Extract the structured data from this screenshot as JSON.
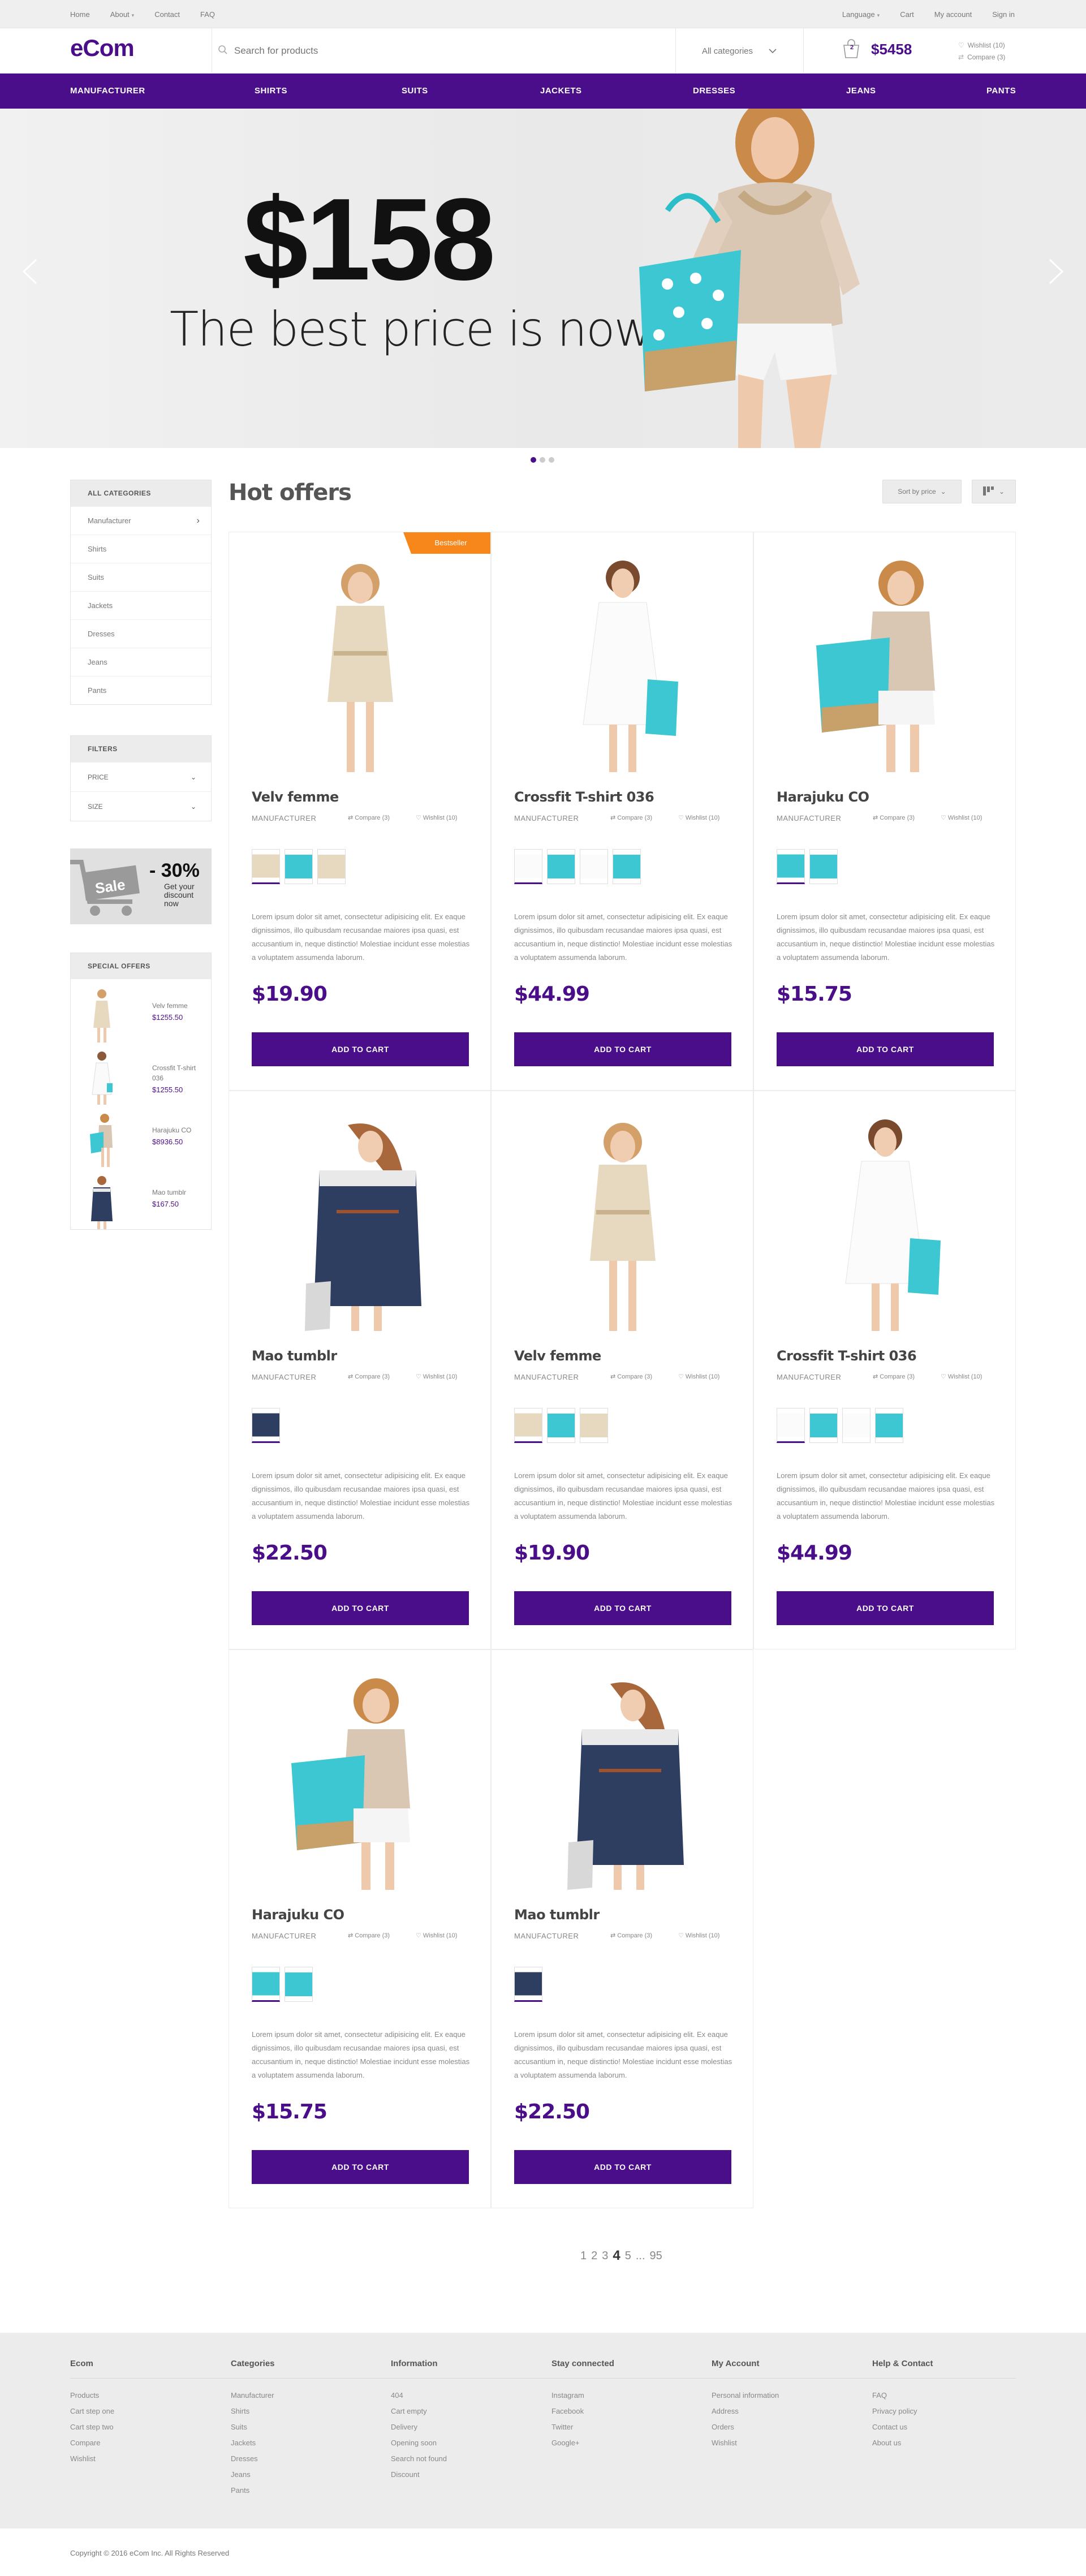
{
  "topbar": {
    "left": [
      "Home",
      "About",
      "Contact",
      "FAQ"
    ],
    "right": [
      "Language",
      "Cart",
      "My account",
      "Sign in"
    ]
  },
  "header": {
    "logo": "eCom",
    "search_placeholder": "Search for products",
    "category_select": "All categories",
    "cart_count": "2",
    "cart_total": "$5458",
    "wishlist": "Wishlist (10)",
    "compare": "Compare (3)"
  },
  "nav": [
    "MANUFACTURER",
    "SHIRTS",
    "SUITS",
    "JACKETS",
    "DRESSES",
    "JEANS",
    "PANTS"
  ],
  "hero": {
    "price": "$158",
    "tagline": "The best price is now"
  },
  "sidebar": {
    "categories_title": "ALL CATEGORIES",
    "categories": [
      "Manufacturer",
      "Shirts",
      "Suits",
      "Jackets",
      "Dresses",
      "Jeans",
      "Pants"
    ],
    "filters_title": "FILTERS",
    "filters": [
      "PRICE",
      "SIZE"
    ],
    "sale": {
      "label": "Sale",
      "discount": "- 30%",
      "line1": "Get your",
      "line2": "discount",
      "line3": "now"
    },
    "special_title": "SPECIAL OFFERS",
    "special": [
      {
        "name": "Velv femme",
        "price": "$1255.50"
      },
      {
        "name": "Crossfit T-shirt 036",
        "price": "$1255.50"
      },
      {
        "name": "Harajuku CO",
        "price": "$8936.50"
      },
      {
        "name": "Mao tumblr",
        "price": "$167.50"
      }
    ]
  },
  "main": {
    "title": "Hot offers",
    "sort_label": "Sort by price",
    "badge": "Bestseller",
    "manufacturer": "MANUFACTURER",
    "compare": "Compare (3)",
    "wishlist": "Wishlist (10)",
    "add_to_cart": "ADD TO CART",
    "description": "Lorem ipsum dolor sit amet, consectetur adipisicing elit. Ex eaque dignissimos, illo quibusdam recusandae maiores ipsa quasi, est accusantium in, neque distinctio! Molestiae incidunt esse molestias a voluptatem assumenda laborum.",
    "products": [
      {
        "name": "Velv femme",
        "price": "$19.90"
      },
      {
        "name": "Crossfit T-shirt 036",
        "price": "$44.99"
      },
      {
        "name": "Harajuku CO",
        "price": "$15.75"
      },
      {
        "name": "Mao tumblr",
        "price": "$22.50"
      },
      {
        "name": "Velv femme",
        "price": "$19.90"
      },
      {
        "name": "Crossfit T-shirt 036",
        "price": "$44.99"
      },
      {
        "name": "Harajuku CO",
        "price": "$15.75"
      },
      {
        "name": "Mao tumblr",
        "price": "$22.50"
      }
    ],
    "pagination": [
      "1",
      "2",
      "3",
      "4",
      "5",
      "...",
      "95"
    ]
  },
  "footer": {
    "columns": [
      {
        "title": "Ecom",
        "links": [
          "Products",
          "Cart step one",
          "Cart step two",
          "Compare",
          "Wishlist"
        ]
      },
      {
        "title": "Categories",
        "links": [
          "Manufacturer",
          "Shirts",
          "Suits",
          "Jackets",
          "Dresses",
          "Jeans",
          "Pants"
        ]
      },
      {
        "title": "Information",
        "links": [
          "404",
          "Cart empty",
          "Delivery",
          "Opening soon",
          "Search not found",
          "Discount"
        ]
      },
      {
        "title": "Stay connected",
        "links": [
          "Instagram",
          "Facebook",
          "Twitter",
          "Google+"
        ]
      },
      {
        "title": "My Account",
        "links": [
          "Personal information",
          "Address",
          "Orders",
          "Wishlist"
        ]
      },
      {
        "title": "Help & Contact",
        "links": [
          "FAQ",
          "Privacy policy",
          "Contact us",
          "About us"
        ]
      }
    ],
    "copyright": "Copyright © 2016 eCom Inc. All Rights Reserved"
  },
  "colors": {
    "brand": "#4b0e8a",
    "badge": "#f7861b"
  }
}
